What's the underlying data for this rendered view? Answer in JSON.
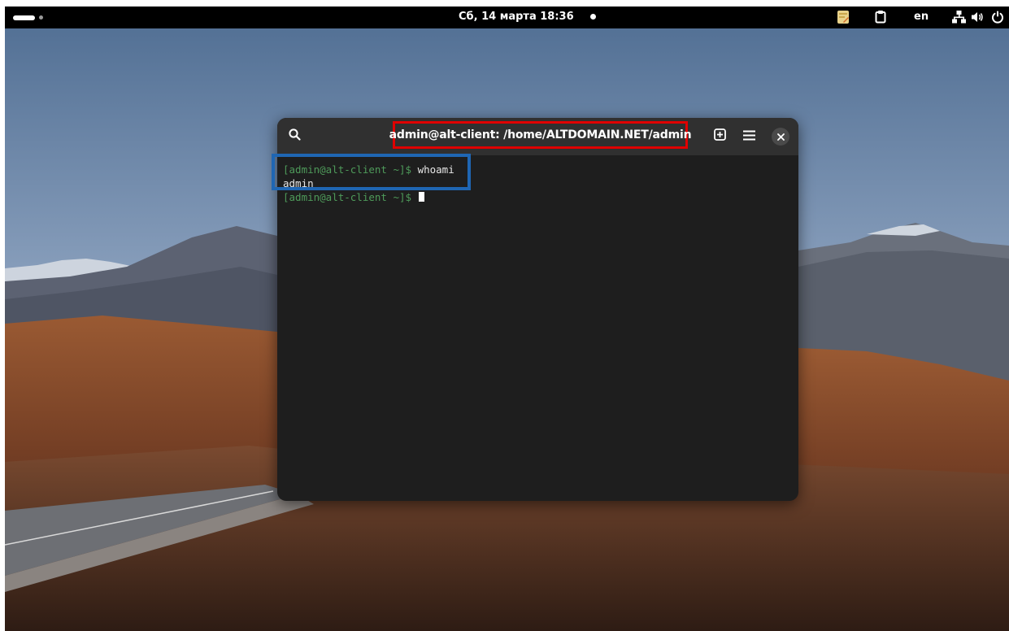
{
  "topbar": {
    "clock": "Сб, 14 марта 18:36",
    "language": "en",
    "tray_icons": [
      "activities-icon",
      "notes-app-icon",
      "clipboard-icon",
      "network-icon",
      "volume-icon",
      "power-icon"
    ]
  },
  "terminal": {
    "title": "admin@alt-client: /home/ALTDOMAIN.NET/admin",
    "header_icons": [
      "search-icon",
      "new-tab-icon",
      "menu-icon",
      "close-icon"
    ],
    "lines": [
      {
        "prompt": "[admin@alt-client ~]$ ",
        "command": "whoami"
      },
      {
        "output": "admin"
      },
      {
        "prompt": "[admin@alt-client ~]$ ",
        "command": ""
      }
    ]
  },
  "colors": {
    "topbar_bg": "#000000",
    "terminal_bg": "#1e1e1e",
    "headerbar_bg": "#303030",
    "prompt_green": "#4e9a5a",
    "highlight_red": "#e00000",
    "highlight_blue": "#1f66b3"
  }
}
